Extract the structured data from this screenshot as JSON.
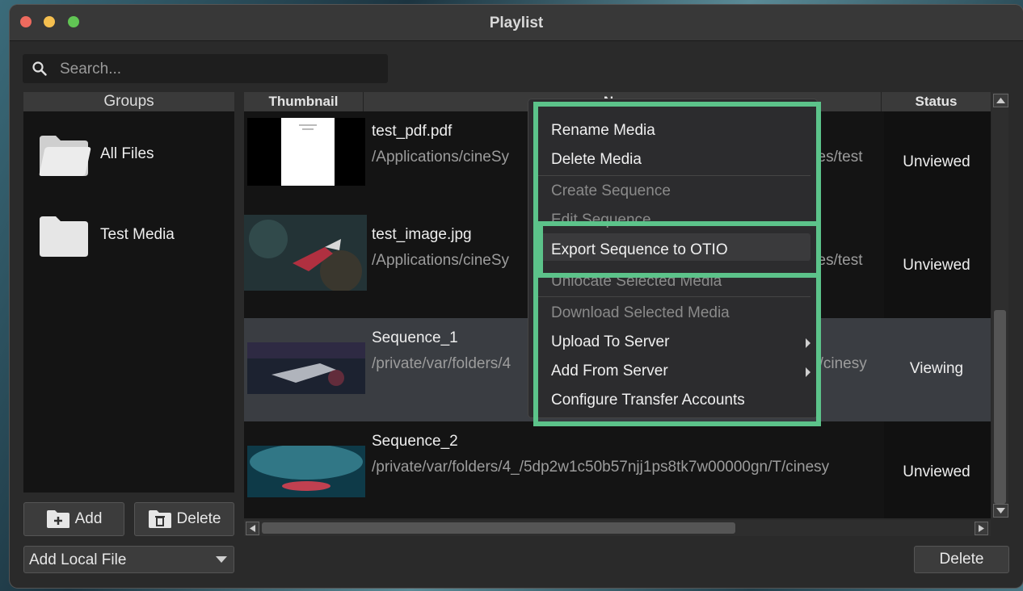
{
  "window": {
    "title": "Playlist"
  },
  "search": {
    "placeholder": "Search..."
  },
  "groups": {
    "header": "Groups",
    "items": [
      {
        "label": "All Files"
      },
      {
        "label": "Test Media"
      }
    ],
    "add_label": "Add",
    "delete_label": "Delete",
    "add_local_file": "Add Local File"
  },
  "table": {
    "columns": {
      "thumbnail": "Thumbnail",
      "name": "Name",
      "status": "Status"
    },
    "rows": [
      {
        "name": "test_pdf.pdf",
        "path": "/Applications/cineSy",
        "path_right": "ces/test",
        "status": "Unviewed"
      },
      {
        "name": "test_image.jpg",
        "path": "/Applications/cineSy",
        "path_right": "ces/test",
        "status": "Unviewed"
      },
      {
        "name": "Sequence_1",
        "path": "/private/var/folders/4",
        "path_right": "T/cinesy",
        "status": "Viewing"
      },
      {
        "name": "Sequence_2",
        "path": "/private/var/folders/4_/5dp2w1c50b57njj1ps8tk7w00000gn/T/cinesy",
        "path_right": "",
        "status": "Unviewed"
      }
    ]
  },
  "context_menu": {
    "items": [
      {
        "label": "Rename Media",
        "enabled": true
      },
      {
        "label": "Delete Media",
        "enabled": true
      },
      {
        "label": "Create Sequence",
        "enabled": false
      },
      {
        "label": "Edit Sequence",
        "enabled": false
      },
      {
        "label": "Export Sequence to OTIO",
        "enabled": true
      },
      {
        "label": "Unlocate Selected Media",
        "enabled": false
      },
      {
        "label": "Download Selected Media",
        "enabled": false
      },
      {
        "label": "Upload To Server",
        "enabled": true,
        "submenu": true
      },
      {
        "label": "Add From Server",
        "enabled": true,
        "submenu": true
      },
      {
        "label": "Configure Transfer Accounts",
        "enabled": true
      }
    ]
  },
  "footer": {
    "delete_label": "Delete"
  },
  "colors": {
    "highlight": "#5cc38a",
    "selected_row": "#3a3d42"
  }
}
